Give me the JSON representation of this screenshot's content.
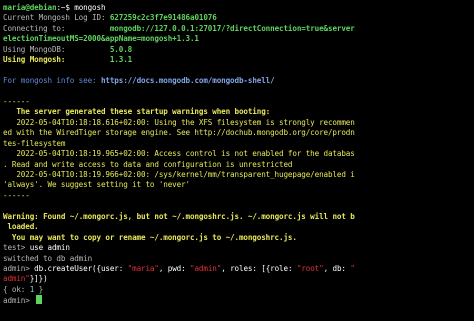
{
  "terminal": {
    "prompt_user": "maria@debian",
    "prompt_path": ":~$ ",
    "command": "mongosh",
    "log_id_label": "Current Mongosh Log ID:",
    "log_id": "627259c2c3f7e91486a01076",
    "connecting_label": "Connecting to:",
    "connecting_url_a": "mongodb://127.0.0.1:27017/?directConnection=true&server",
    "connecting_url_b": "electionTimeoutMS=2000&appName=mongosh+1.3.1",
    "mongodb_label": "Using MongoDB:",
    "mongodb_version": "5.0.8",
    "mongosh_label": "Using Mongosh:",
    "mongosh_version": "1.3.1",
    "info_prefix": "For mongosh info see: ",
    "info_url": "https://docs.mongodb.com/mongodb-shell/",
    "separator": "------",
    "warn_header": "   The server generated these startup warnings when booting:",
    "warn1_a": "   2022-05-04T10:18:18.616+02:00: Using the XFS filesystem is strongly recommen",
    "warn1_b": "ed with the WiredTiger storage engine. See http://dochub.mongodb.org/core/prodn",
    "warn1_c": "tes-filesystem",
    "warn2_a": "   2022-05-04T10:18:19.965+02:00: Access control is not enabled for the databas",
    "warn2_b": ". Read and write access to data and configuration is unrestricted",
    "warn3_a": "   2022-05-04T10:18:19.966+02:00: /sys/kernel/mm/transparent_hugepage/enabled i",
    "warn3_b": "'always'. We suggest setting it to 'never'",
    "rc_warn_label": "Warning:",
    "rc_warn_text": " Found ~/.mongorc.js, but not ~/.mongoshrc.js. ~/.mongorc.js will not b",
    "rc_warn_text2": " loaded.",
    "rc_warn_hint": "  You may want to copy or rename ~/.mongorc.js to ~/.mongoshrc.js.",
    "prompt_test": "test> ",
    "cmd_use": "use admin",
    "switched": "switched to db admin",
    "prompt_admin": "admin> ",
    "cu_a": "db.createUser({user: ",
    "cu_user": "\"maria\"",
    "cu_b": ", pwd: ",
    "cu_pwd": "\"admin\"",
    "cu_c": ", roles: [{role: ",
    "cu_role": "\"root\"",
    "cu_d": ", db: ",
    "cu_db_a": "\"",
    "cu_db_b": "admin\"",
    "cu_e": "}]})",
    "ok_a": "{ ok: ",
    "ok_val": "1",
    "ok_b": " }"
  }
}
